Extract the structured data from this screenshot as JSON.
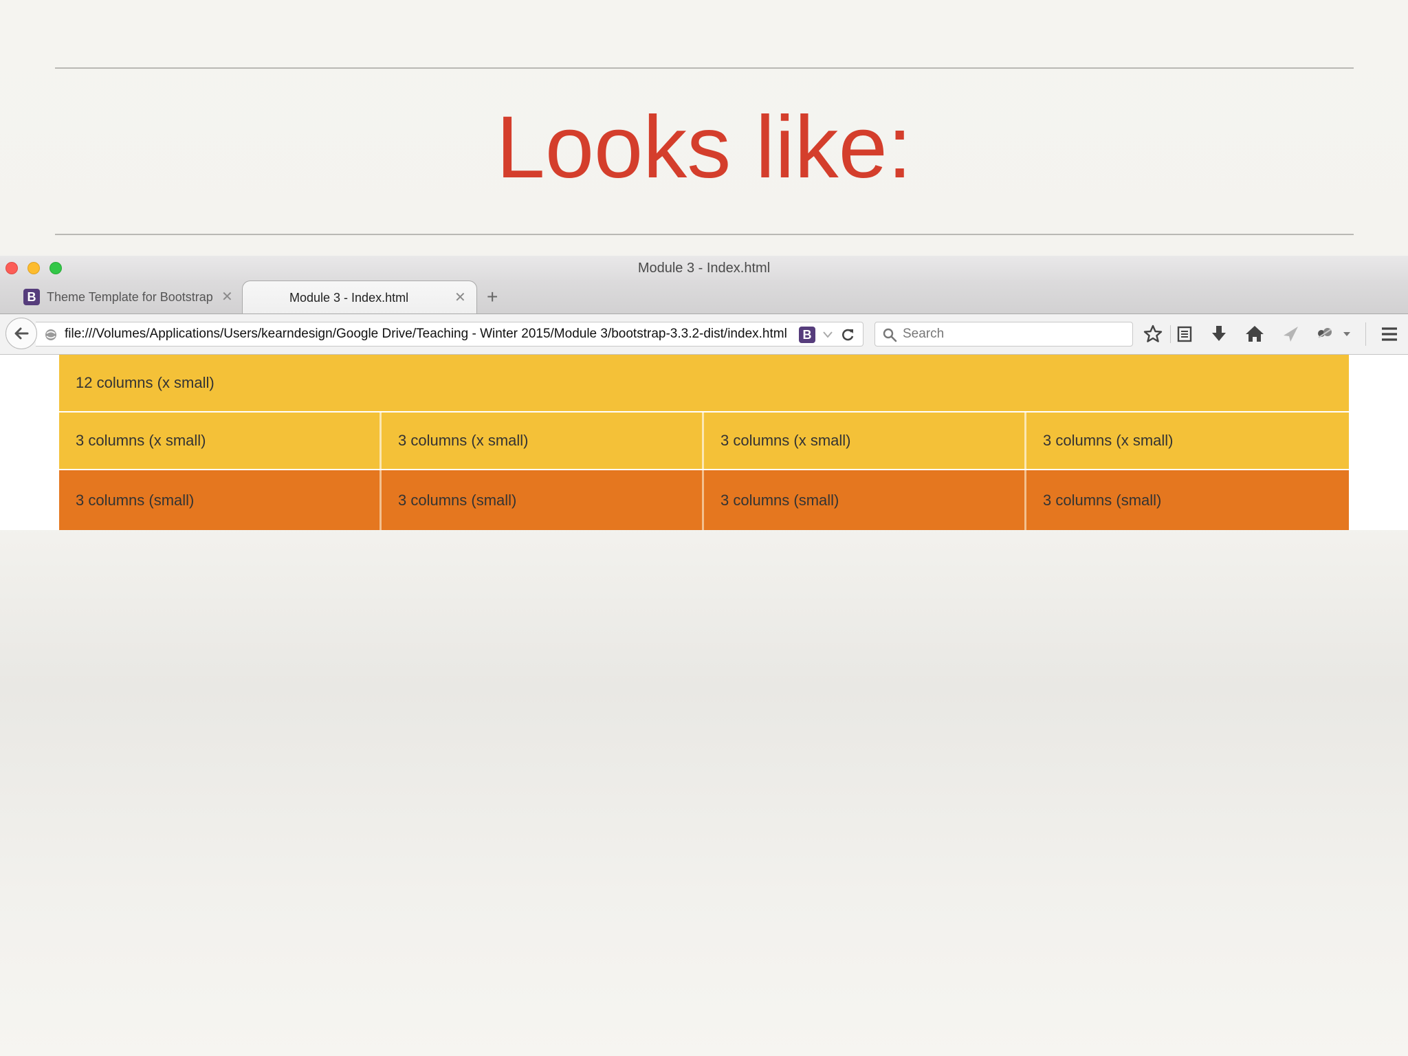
{
  "slide": {
    "title": "Looks like:"
  },
  "browser": {
    "window_title": "Module 3 - Index.html",
    "tabs": [
      {
        "label": "Theme Template for Bootstrap",
        "favicon": "B",
        "active": false
      },
      {
        "label": "Module 3 - Index.html",
        "active": true
      }
    ],
    "address": "file:///Volumes/Applications/Users/kearndesign/Google Drive/Teaching - Winter 2015/Module 3/bootstrap-3.3.2-dist/index.html",
    "address_badge": "B",
    "search_placeholder": "Search",
    "toolbar_icons": [
      "bookmark-star-icon",
      "reading-list-icon",
      "download-icon",
      "home-icon",
      "share-icon",
      "extension-icon",
      "menu-icon"
    ],
    "colors": {
      "traffic_close": "#fc5d57",
      "traffic_minimize": "#fdbc2e",
      "traffic_zoom": "#33c748",
      "xs_cell": "#f4c138",
      "sm_cell": "#e5771f",
      "title": "#d43e2c"
    }
  },
  "grid": {
    "row_full": "12 columns (x small)",
    "row_xs": [
      "3 columns (x small)",
      "3 columns (x small)",
      "3 columns (x small)",
      "3 columns (x small)"
    ],
    "row_sm": [
      "3 columns (small)",
      "3 columns (small)",
      "3 columns (small)",
      "3 columns (small)"
    ]
  }
}
